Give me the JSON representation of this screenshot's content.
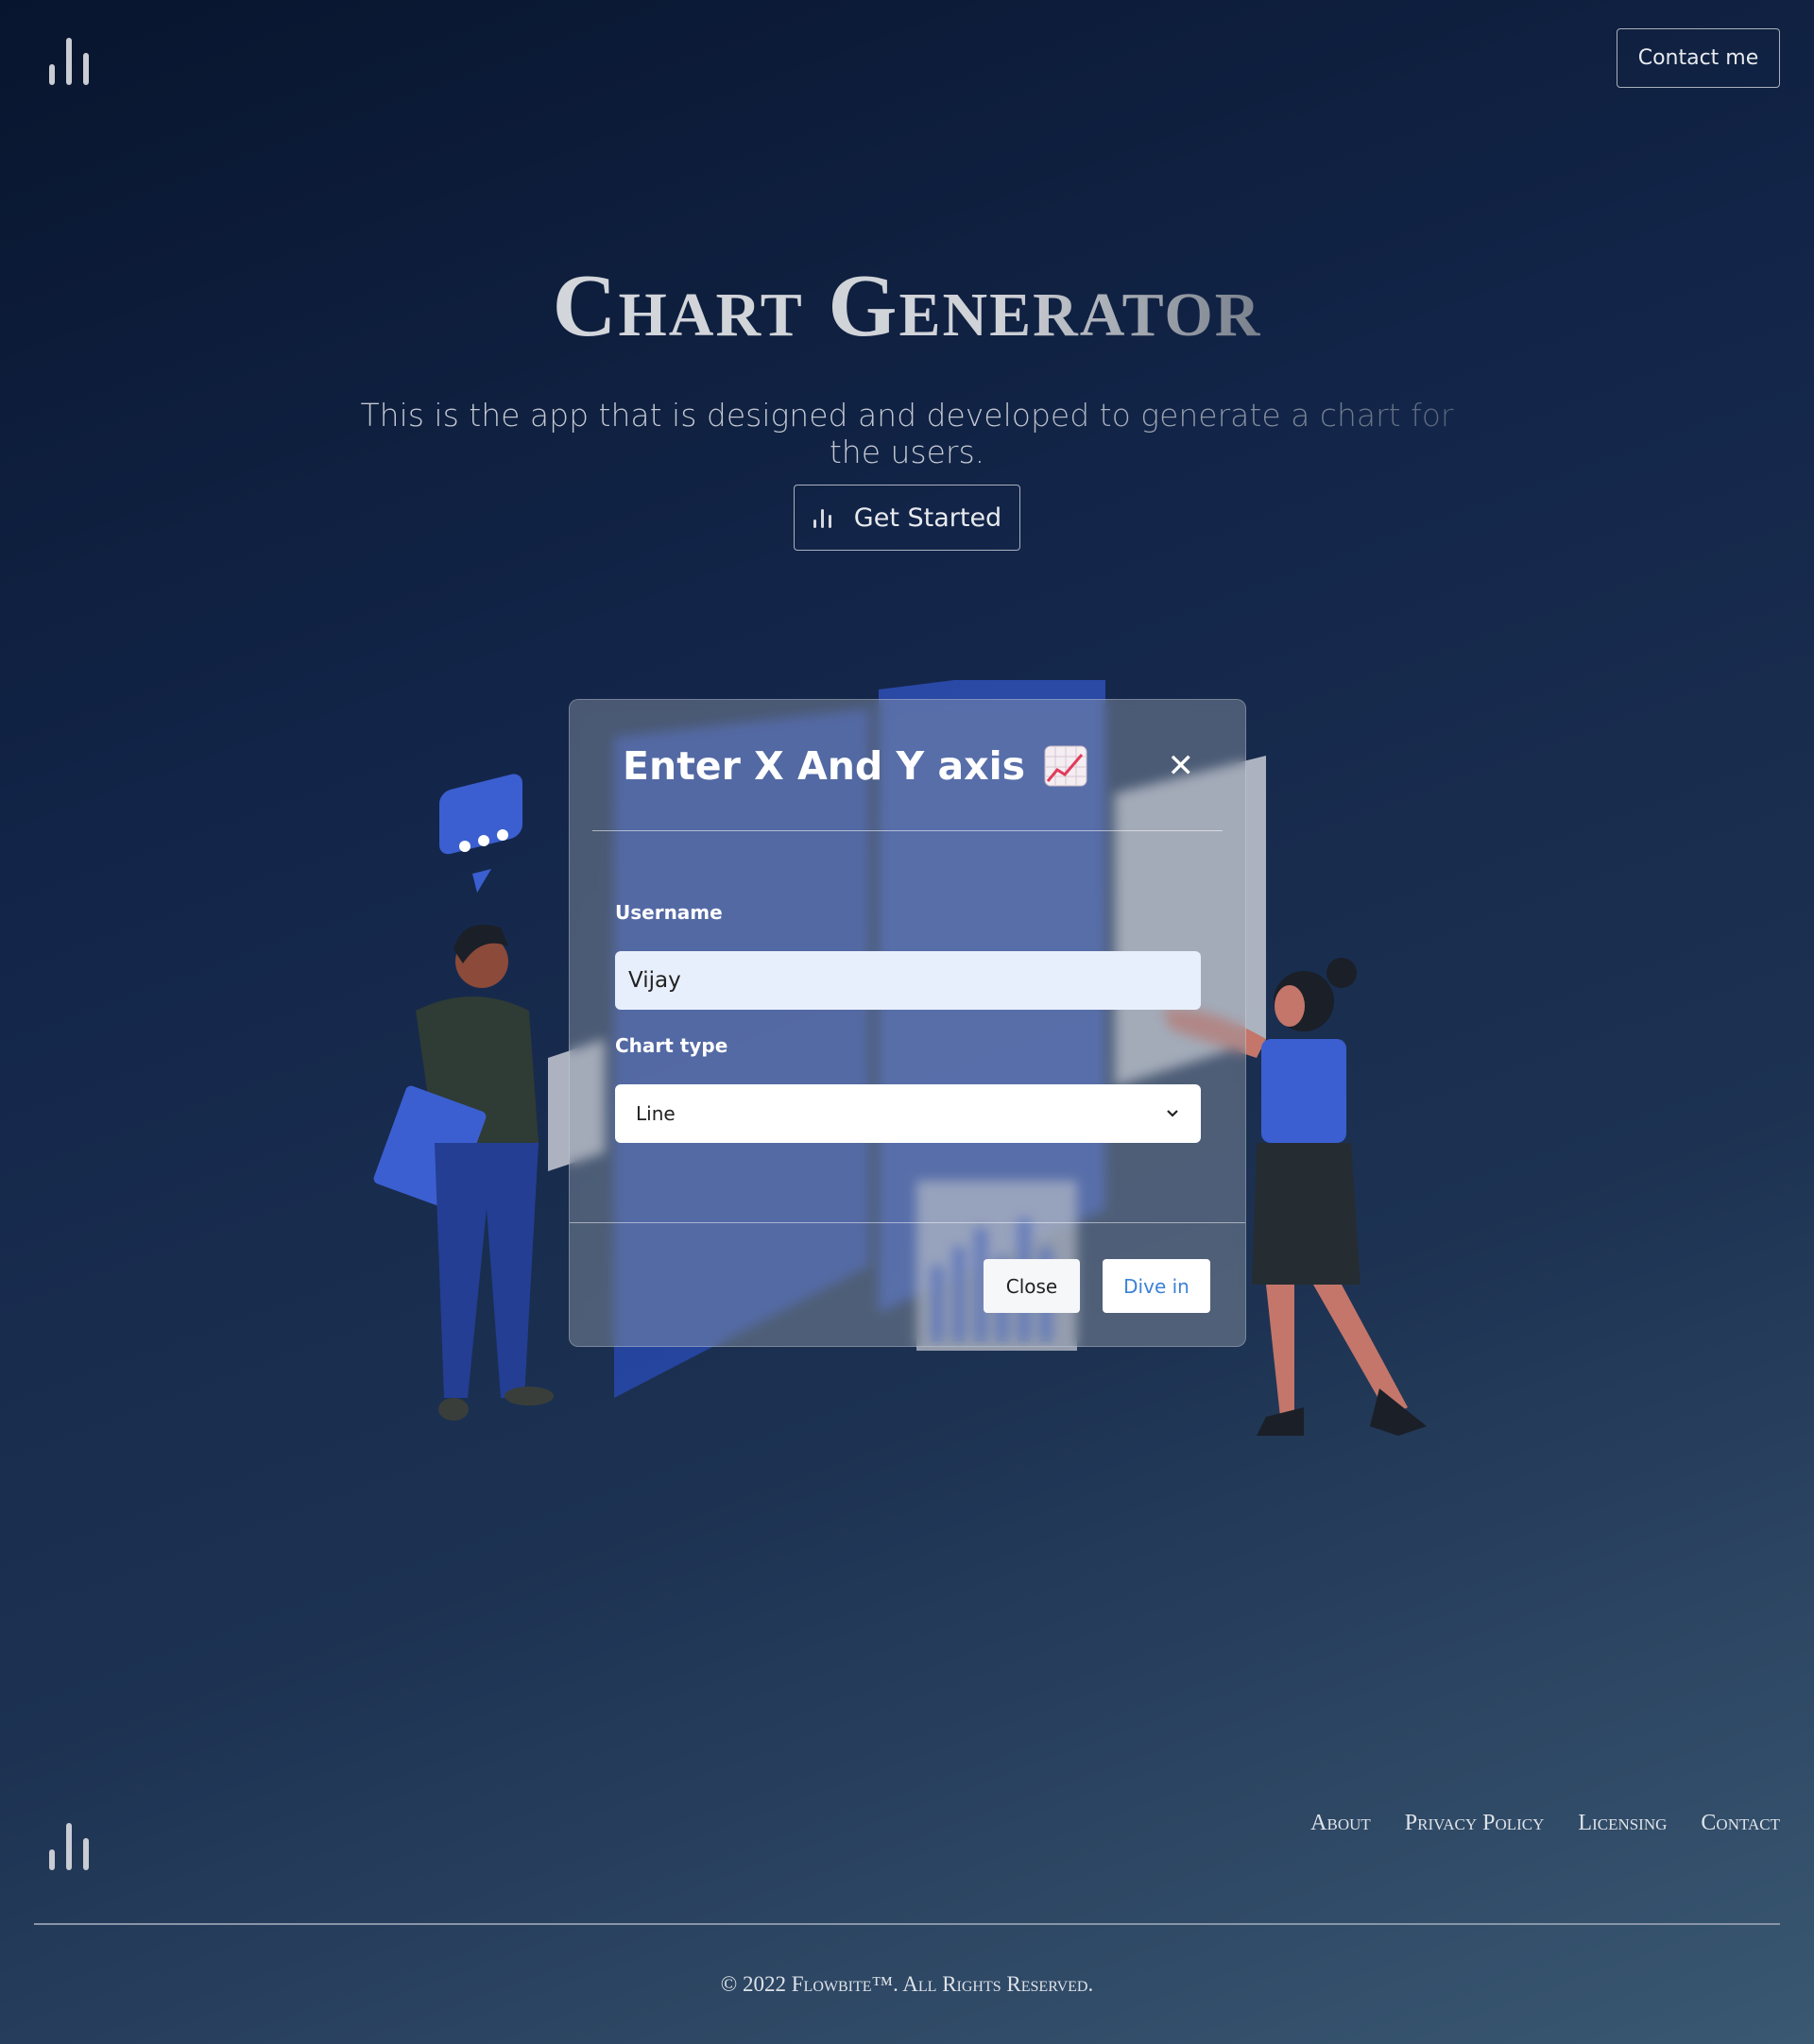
{
  "header": {
    "logo_icon": "bar-chart-logo-icon",
    "contact_label": "Contact me"
  },
  "hero": {
    "title": "Chart Generator",
    "subtitle": "This is the app that is designed and developed to generate a chart for the users.",
    "cta_label": "Get Started",
    "cta_icon": "bar-chart-icon"
  },
  "modal": {
    "title": "Enter X And Y axis",
    "title_icon": "chart-increasing-emoji-icon",
    "close_icon": "close-icon",
    "username_label": "Username",
    "username_value": "Vijay",
    "chart_type_label": "Chart type",
    "chart_type_value": "Line",
    "close_button": "Close",
    "submit_button": "Dive in"
  },
  "footer": {
    "logo_icon": "bar-chart-logo-icon",
    "links": [
      "About",
      "Privacy Policy",
      "Licensing",
      "Contact"
    ],
    "copyright": "© 2022 Flowbite™. All Rights Reserved."
  },
  "colors": {
    "background_top": "#08152e",
    "background_bottom": "#3a5872",
    "accent_blue": "#3b5fd0",
    "submit_text": "#3b82d6"
  }
}
